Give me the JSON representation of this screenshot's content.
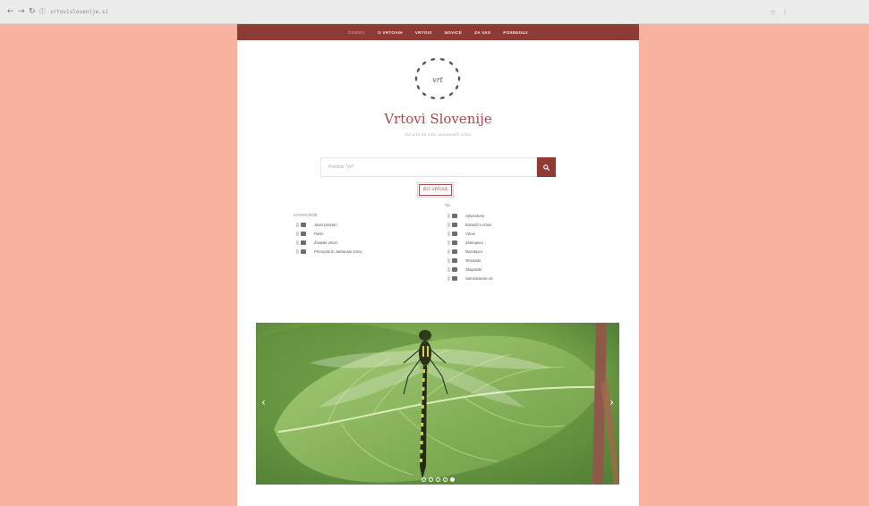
{
  "browser": {
    "back": "←",
    "forward": "→",
    "reload": "↻",
    "url": "vrtovislovenije.si",
    "menu_glyph": "⋮"
  },
  "nav": {
    "items": [
      "DOMOV",
      "O VRTOVIH",
      "VRTOVI",
      "NOVICE",
      "ZA VAS",
      "POSREDUJ"
    ]
  },
  "site": {
    "logo_text": "vrt",
    "title": "Vrtovi Slovenije",
    "tagline": "Od vrta do vrta, slovenskih vrtov"
  },
  "search": {
    "placeholder": "Poiščite \"Vrt\"",
    "button_icon": "search-icon",
    "filter_label": "IŠČI VRTOVE"
  },
  "filters": {
    "left_heading": "KATEGORIJE",
    "left": [
      "Javni prostori",
      "Parki",
      "Živalski vrtovi",
      "Primorski in Jadranski vrtovi"
    ],
    "right_heading": "Tip",
    "right": [
      "Arboretumi",
      "Botanični vrtovi",
      "Vrtovi",
      "Zelenjavni",
      "Razstavni",
      "Tematski",
      "Skupinski",
      "Samostanski vrt"
    ]
  },
  "slider": {
    "prev": "‹",
    "next": "›",
    "slides": 5,
    "active_slide": 5
  },
  "colors": {
    "background": "#f7b3a0",
    "brand": "#8e3a35",
    "title": "#a9484e"
  }
}
